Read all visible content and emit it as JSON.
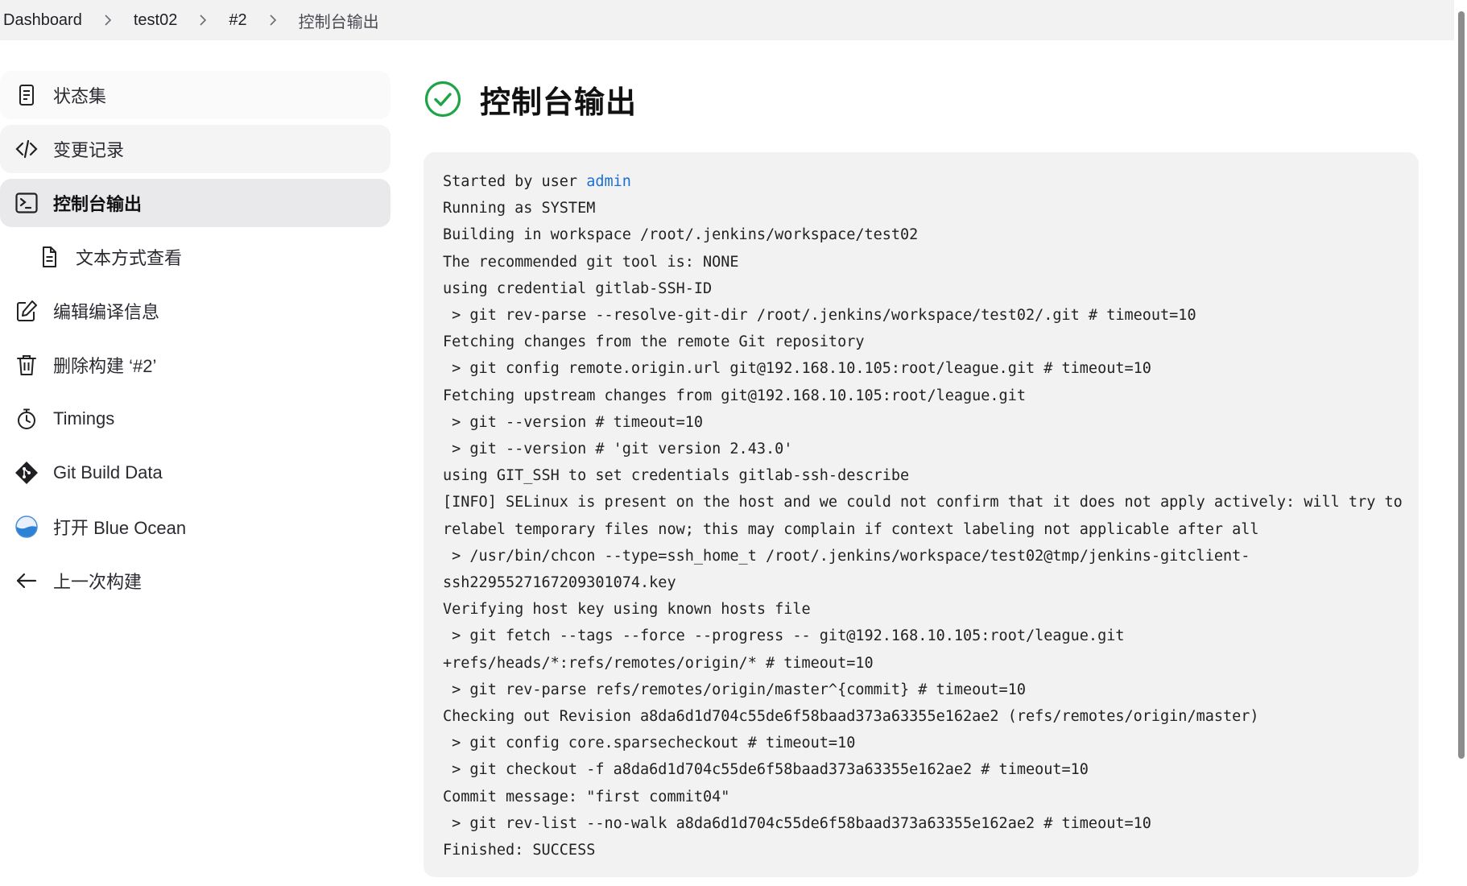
{
  "breadcrumb": {
    "items": [
      "Dashboard",
      "test02",
      "#2",
      "控制台输出"
    ]
  },
  "sidebar": {
    "items": [
      {
        "label": "状态集",
        "icon": "notepad-icon"
      },
      {
        "label": "变更记录",
        "icon": "code-icon"
      },
      {
        "label": "控制台输出",
        "icon": "terminal-icon"
      },
      {
        "label": "文本方式查看",
        "icon": "document-icon"
      },
      {
        "label": "编辑编译信息",
        "icon": "edit-icon"
      },
      {
        "label": "删除构建 ‘#2’",
        "icon": "trash-icon"
      },
      {
        "label": "Timings",
        "icon": "stopwatch-icon"
      },
      {
        "label": "Git Build Data",
        "icon": "git-icon"
      },
      {
        "label": "打开 Blue Ocean",
        "icon": "blue-ocean-icon"
      },
      {
        "label": "上一次构建",
        "icon": "arrow-left-icon"
      }
    ]
  },
  "main": {
    "title": "控制台输出",
    "status_icon": "success-check-icon",
    "status_color": "#1ea446"
  },
  "console": {
    "started_prefix": "Started by user ",
    "started_user": "admin",
    "lines": [
      "Running as SYSTEM",
      "Building in workspace /root/.jenkins/workspace/test02",
      "The recommended git tool is: NONE",
      "using credential gitlab-SSH-ID",
      " > git rev-parse --resolve-git-dir /root/.jenkins/workspace/test02/.git # timeout=10",
      "Fetching changes from the remote Git repository",
      " > git config remote.origin.url git@192.168.10.105:root/league.git # timeout=10",
      "Fetching upstream changes from git@192.168.10.105:root/league.git",
      " > git --version # timeout=10",
      " > git --version # 'git version 2.43.0'",
      "using GIT_SSH to set credentials gitlab-ssh-describe",
      "[INFO] SELinux is present on the host and we could not confirm that it does not apply actively: will try to",
      "relabel temporary files now; this may complain if context labeling not applicable after all",
      " > /usr/bin/chcon --type=ssh_home_t /root/.jenkins/workspace/test02@tmp/jenkins-gitclient-",
      "ssh2295527167209301074.key",
      "Verifying host key using known hosts file",
      " > git fetch --tags --force --progress -- git@192.168.10.105:root/league.git",
      "+refs/heads/*:refs/remotes/origin/* # timeout=10",
      " > git rev-parse refs/remotes/origin/master^{commit} # timeout=10",
      "Checking out Revision a8da6d1d704c55de6f58baad373a63355e162ae2 (refs/remotes/origin/master)",
      " > git config core.sparsecheckout # timeout=10",
      " > git checkout -f a8da6d1d704c55de6f58baad373a63355e162ae2 # timeout=10",
      "Commit message: \"first commit04\"",
      " > git rev-list --no-walk a8da6d1d704c55de6f58baad373a63355e162ae2 # timeout=10",
      "Finished: SUCCESS"
    ]
  }
}
